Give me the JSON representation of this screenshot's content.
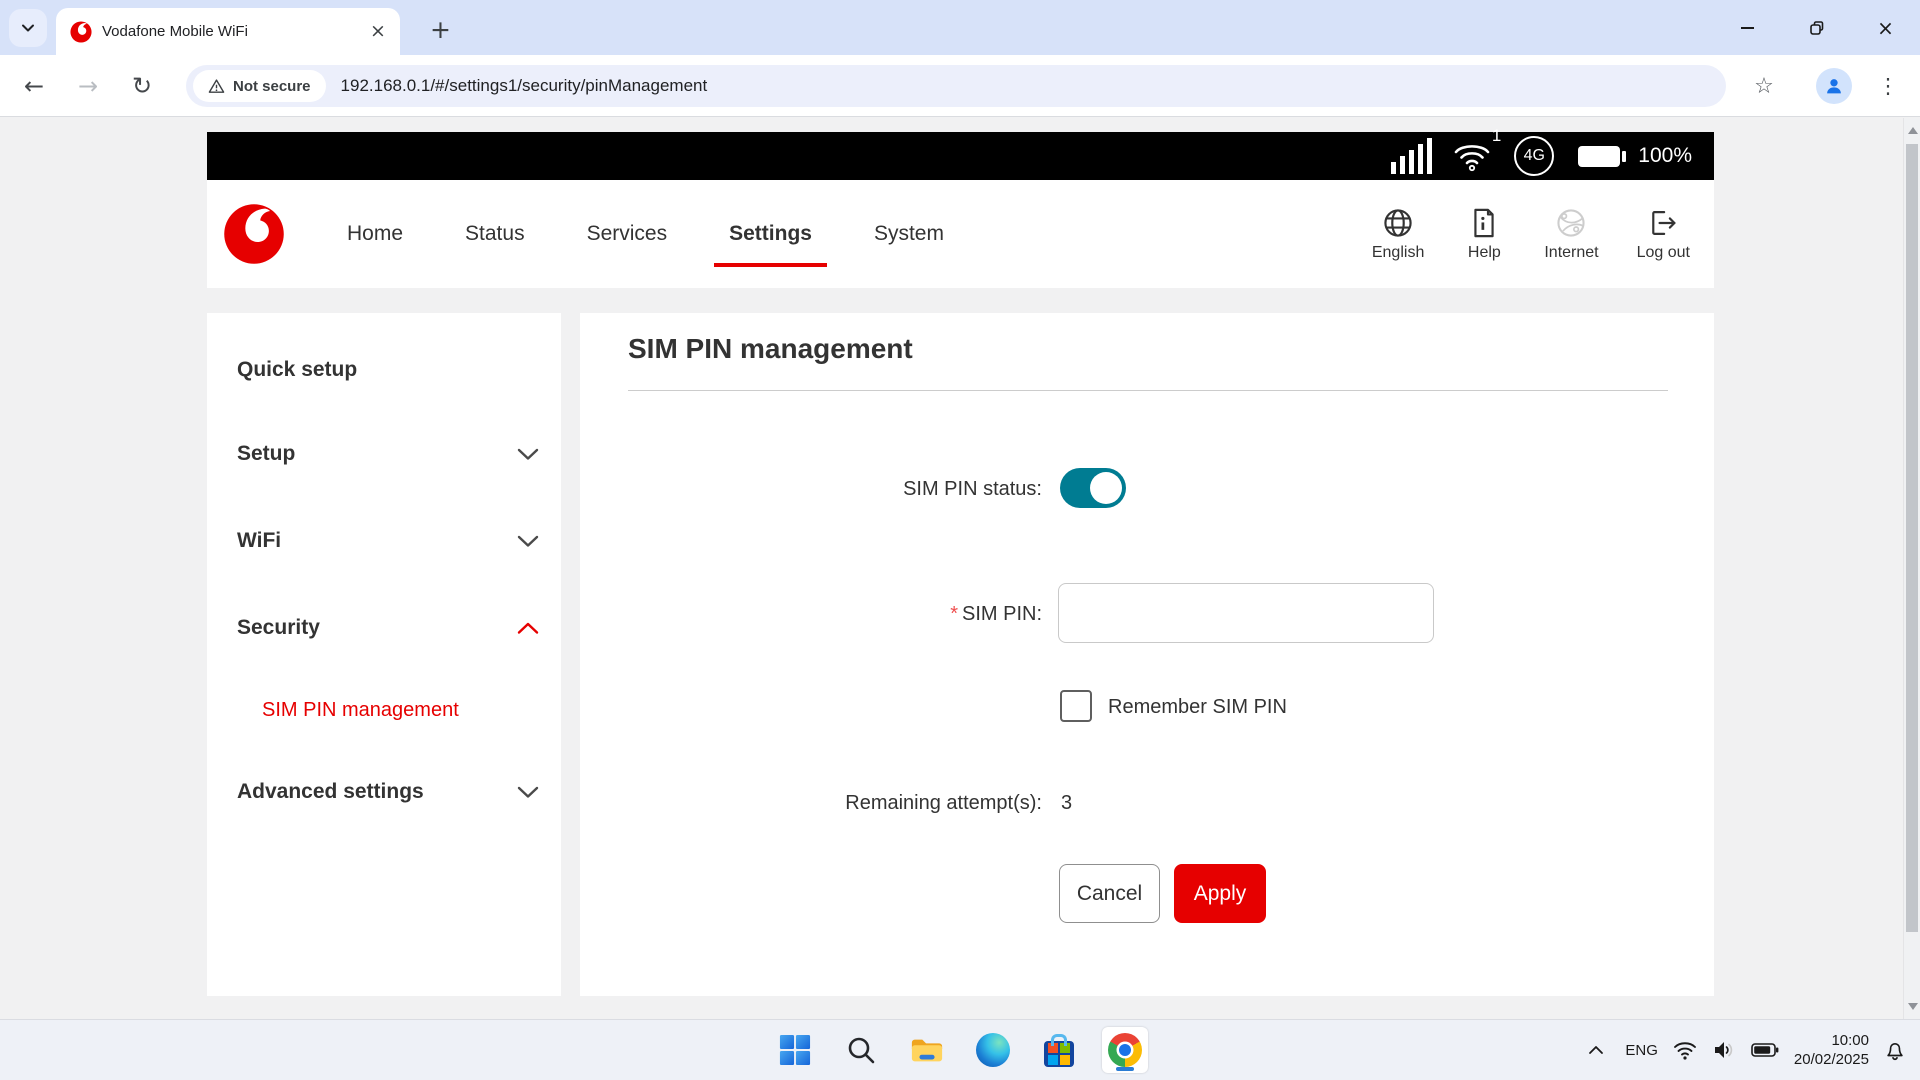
{
  "browser": {
    "tab_title": "Vodafone Mobile WiFi",
    "url": "192.168.0.1/#/settings1/security/pinManagement",
    "security_chip": "Not secure",
    "glyphs": {
      "back": "←",
      "forward": "→",
      "reload": "↻",
      "star": "☆",
      "menu": "⋮",
      "close": "×",
      "new_tab": "+"
    }
  },
  "device_bar": {
    "wifi_clients": "1",
    "network": "4G",
    "battery": "100%"
  },
  "site": {
    "brand": "Vodafone",
    "nav": [
      {
        "label": "Home"
      },
      {
        "label": "Status"
      },
      {
        "label": "Services"
      },
      {
        "label": "Settings",
        "active": true
      },
      {
        "label": "System"
      }
    ],
    "actions": [
      {
        "label": "English",
        "icon": "globe-icon"
      },
      {
        "label": "Help",
        "icon": "document-info-icon"
      },
      {
        "label": "Internet",
        "icon": "network-globe-icon",
        "disabled": true
      },
      {
        "label": "Log out",
        "icon": "logout-icon"
      }
    ]
  },
  "sidebar": {
    "items": [
      {
        "label": "Quick setup"
      },
      {
        "label": "Setup",
        "chevron": "down"
      },
      {
        "label": "WiFi",
        "chevron": "down"
      },
      {
        "label": "Security",
        "chevron": "up",
        "expanded": true
      },
      {
        "label": "SIM PIN management",
        "child": true,
        "active": true
      },
      {
        "label": "Advanced settings",
        "chevron": "down"
      }
    ]
  },
  "main": {
    "title": "SIM PIN management",
    "status_label": "SIM PIN status:",
    "status_on": true,
    "required_mark": "*",
    "pin_label": "SIM PIN:",
    "pin_value": "",
    "remember_label": "Remember SIM PIN",
    "remember_checked": false,
    "attempts_label": "Remaining attempt(s):",
    "attempts_value": "3",
    "cancel_label": "Cancel",
    "apply_label": "Apply"
  },
  "taskbar": {
    "language": "ENG",
    "time": "10:00",
    "date": "20/02/2025"
  },
  "colors": {
    "brand_red": "#e60000",
    "toggle_teal": "#007c92"
  }
}
